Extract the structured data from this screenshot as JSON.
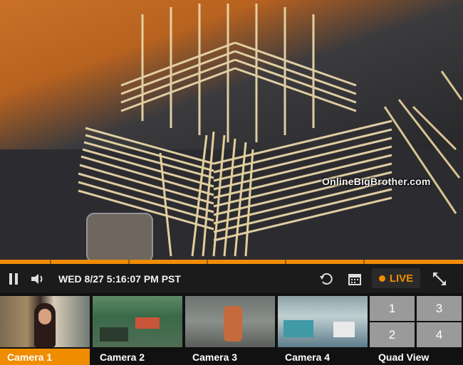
{
  "player": {
    "timestamp": "WED 8/27 5:16:07 PM PST",
    "live_label": "LIVE",
    "watermark": "OnlineBigBrother.com"
  },
  "icons": {
    "pause": "pause-icon",
    "volume": "volume-icon",
    "replay": "replay-icon",
    "calendar": "calendar-icon",
    "fullscreen": "fullscreen-icon"
  },
  "colors": {
    "accent": "#f08c00",
    "control_bar": "#1b1b1b"
  },
  "cameras": [
    {
      "label": "Camera 1",
      "active": true
    },
    {
      "label": "Camera 2",
      "active": false
    },
    {
      "label": "Camera 3",
      "active": false
    },
    {
      "label": "Camera 4",
      "active": false
    }
  ],
  "quad_view": {
    "label": "Quad View",
    "cells": [
      "1",
      "3",
      "2",
      "4"
    ]
  }
}
